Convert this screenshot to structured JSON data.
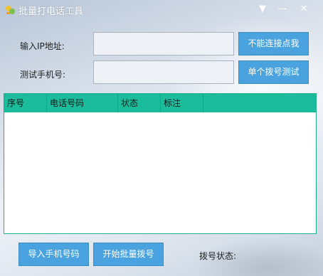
{
  "window": {
    "title": "批量打电话工具",
    "minimize_label": "—",
    "close_label": "✕",
    "menu_label": "▼"
  },
  "form": {
    "ip_label": "输入IP地址:",
    "ip_value": "",
    "phone_label": "测试手机号:",
    "phone_value": ""
  },
  "buttons": {
    "cannot_connect": "不能连接点我",
    "single_dial_test": "单个拨号测试",
    "import_numbers": "导入手机号码",
    "start_batch_dial": "开始批量拨号"
  },
  "grid": {
    "columns": [
      "序号",
      "电话号码",
      "状态",
      "标注"
    ],
    "rows": []
  },
  "status": {
    "label": "拨号状态:",
    "value": ""
  },
  "colors": {
    "accent_button": "#4aa3df",
    "grid_header": "#1abc9c"
  },
  "icons": {
    "app": "app-logo-icon",
    "menu": "dropdown-menu-icon",
    "minimize": "minimize-icon",
    "close": "close-icon"
  }
}
